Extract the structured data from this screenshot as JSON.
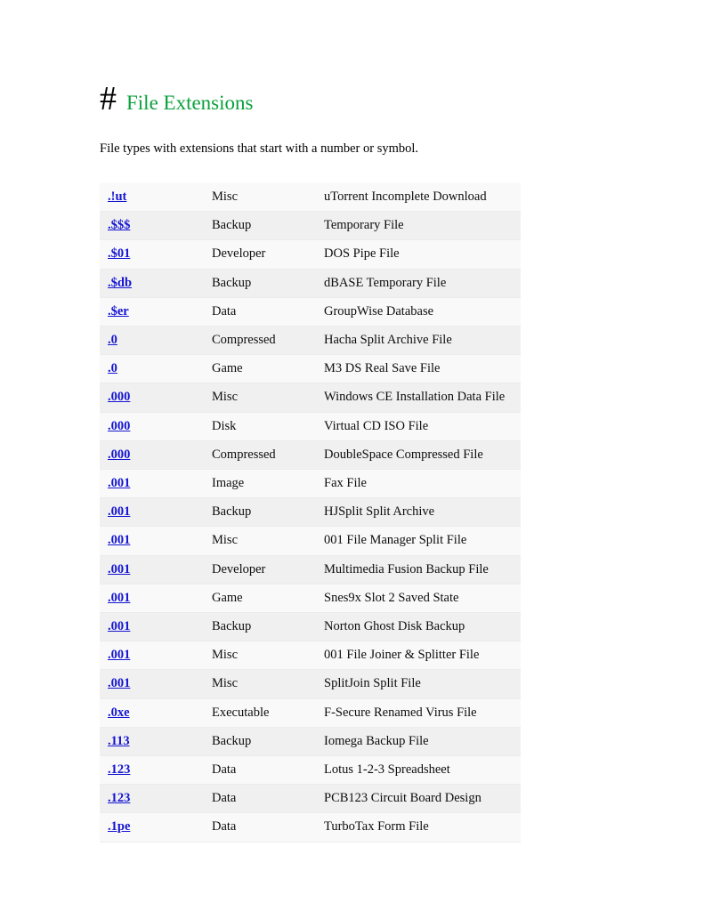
{
  "heading": {
    "symbol": "#",
    "title": "File Extensions",
    "title_color": "#0aa03c",
    "symbol_color": "#000000"
  },
  "intro": "File types with extensions that start with a number or symbol.",
  "table": {
    "link_color": "#1414d2",
    "row_tint_odd": "#f9f9f9",
    "row_tint_even": "#f0f0f0",
    "rows": [
      {
        "extension": ".!ut",
        "category": "Misc",
        "description": "uTorrent Incomplete Download"
      },
      {
        "extension": ".$$$",
        "category": "Backup",
        "description": "Temporary File"
      },
      {
        "extension": ".$01",
        "category": "Developer",
        "description": "DOS Pipe File"
      },
      {
        "extension": ".$db",
        "category": "Backup",
        "description": "dBASE Temporary File"
      },
      {
        "extension": ".$er",
        "category": "Data",
        "description": "GroupWise Database"
      },
      {
        "extension": ".0",
        "category": "Compressed",
        "description": "Hacha Split Archive File"
      },
      {
        "extension": ".0",
        "category": "Game",
        "description": "M3 DS Real Save File"
      },
      {
        "extension": ".000",
        "category": "Misc",
        "description": "Windows CE Installation Data File"
      },
      {
        "extension": ".000",
        "category": "Disk",
        "description": "Virtual CD ISO File"
      },
      {
        "extension": ".000",
        "category": "Compressed",
        "description": "DoubleSpace Compressed File"
      },
      {
        "extension": ".001",
        "category": "Image",
        "description": "Fax File"
      },
      {
        "extension": ".001",
        "category": "Backup",
        "description": "HJSplit Split Archive"
      },
      {
        "extension": ".001",
        "category": "Misc",
        "description": "001 File Manager Split File"
      },
      {
        "extension": ".001",
        "category": "Developer",
        "description": "Multimedia Fusion Backup File"
      },
      {
        "extension": ".001",
        "category": "Game",
        "description": "Snes9x Slot 2 Saved State"
      },
      {
        "extension": ".001",
        "category": "Backup",
        "description": "Norton Ghost Disk Backup"
      },
      {
        "extension": ".001",
        "category": "Misc",
        "description": "001 File Joiner & Splitter File"
      },
      {
        "extension": ".001",
        "category": "Misc",
        "description": "SplitJoin Split File"
      },
      {
        "extension": ".0xe",
        "category": "Executable",
        "description": "F-Secure Renamed Virus File"
      },
      {
        "extension": ".113",
        "category": "Backup",
        "description": "Iomega Backup File"
      },
      {
        "extension": ".123",
        "category": "Data",
        "description": "Lotus 1-2-3 Spreadsheet"
      },
      {
        "extension": ".123",
        "category": "Data",
        "description": "PCB123 Circuit Board Design"
      },
      {
        "extension": ".1pe",
        "category": "Data",
        "description": "TurboTax Form File"
      }
    ]
  }
}
